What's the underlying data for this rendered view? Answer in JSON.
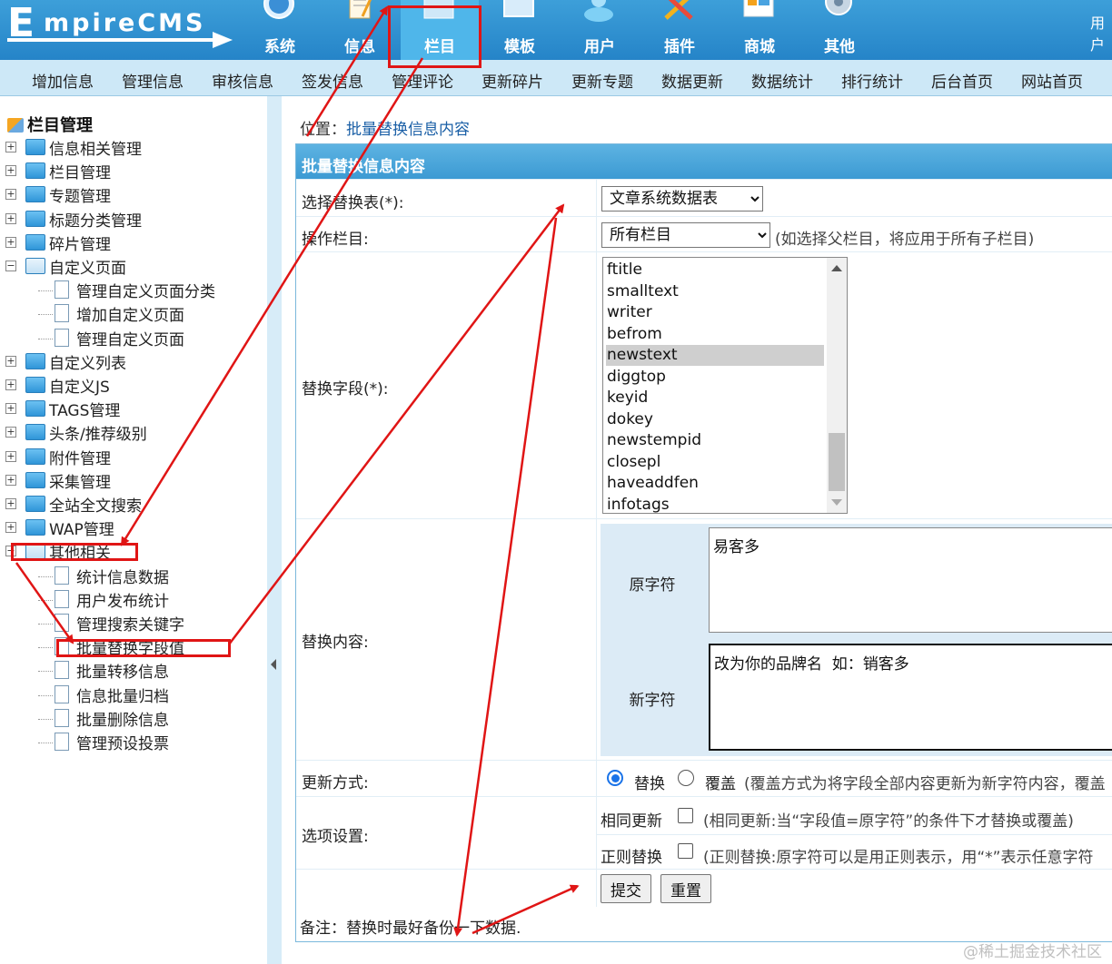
{
  "logo": {
    "e": "E",
    "text": "mpireCMS"
  },
  "nav_tabs": [
    {
      "label": "系统",
      "icon": "globe-icon"
    },
    {
      "label": "信息",
      "icon": "notepad-icon"
    },
    {
      "label": "栏目",
      "icon": "folder-icon",
      "active": true
    },
    {
      "label": "模板",
      "icon": "window-icon"
    },
    {
      "label": "用户",
      "icon": "user-icon"
    },
    {
      "label": "插件",
      "icon": "tools-icon"
    },
    {
      "label": "商城",
      "icon": "shop-icon"
    },
    {
      "label": "其他",
      "icon": "gear-icon"
    }
  ],
  "user_text": "用户",
  "submenu": [
    "增加信息",
    "管理信息",
    "审核信息",
    "签发信息",
    "管理评论",
    "更新碎片",
    "更新专题",
    "数据更新",
    "数据统计",
    "排行统计",
    "后台首页",
    "网站首页"
  ],
  "tree": {
    "title": "栏目管理",
    "items": [
      {
        "label": "信息相关管理",
        "type": "folder",
        "pm": "+"
      },
      {
        "label": "栏目管理",
        "type": "folder",
        "pm": "+"
      },
      {
        "label": "专题管理",
        "type": "folder",
        "pm": "+"
      },
      {
        "label": "标题分类管理",
        "type": "folder",
        "pm": "+"
      },
      {
        "label": "碎片管理",
        "type": "folder",
        "pm": "+"
      },
      {
        "label": "自定义页面",
        "type": "folder-open",
        "pm": "−"
      },
      {
        "label": "管理自定义页面分类",
        "type": "doc"
      },
      {
        "label": "增加自定义页面",
        "type": "doc"
      },
      {
        "label": "管理自定义页面",
        "type": "doc"
      },
      {
        "label": "自定义列表",
        "type": "folder",
        "pm": "+"
      },
      {
        "label": "自定义JS",
        "type": "folder",
        "pm": "+"
      },
      {
        "label": "TAGS管理",
        "type": "folder",
        "pm": "+"
      },
      {
        "label": "头条/推荐级别",
        "type": "folder",
        "pm": "+"
      },
      {
        "label": "附件管理",
        "type": "folder",
        "pm": "+"
      },
      {
        "label": "采集管理",
        "type": "folder",
        "pm": "+"
      },
      {
        "label": "全站全文搜索",
        "type": "folder",
        "pm": "+"
      },
      {
        "label": "WAP管理",
        "type": "folder",
        "pm": "+"
      },
      {
        "label": "其他相关",
        "type": "folder-open",
        "pm": "−"
      },
      {
        "label": "统计信息数据",
        "type": "doc"
      },
      {
        "label": "用户发布统计",
        "type": "doc"
      },
      {
        "label": "管理搜索关键字",
        "type": "doc"
      },
      {
        "label": "批量替换字段值",
        "type": "doc"
      },
      {
        "label": "批量转移信息",
        "type": "doc"
      },
      {
        "label": "信息批量归档",
        "type": "doc"
      },
      {
        "label": "批量删除信息",
        "type": "doc"
      },
      {
        "label": "管理预设投票",
        "type": "doc"
      }
    ]
  },
  "crumb": {
    "prefix": "位置：",
    "link": "批量替换信息内容"
  },
  "form": {
    "title": "批量替换信息内容",
    "table_label": "选择替换表(*):",
    "table_value": "文章系统数据表",
    "column_label": "操作栏目:",
    "column_value": "所有栏目",
    "column_hint": "(如选择父栏目，将应用于所有子栏目)",
    "field_label": "替换字段(*):",
    "field_options": [
      "ftitle",
      "smalltext",
      "writer",
      "befrom",
      "newstext",
      "diggtop",
      "keyid",
      "dokey",
      "newstempid",
      "closepl",
      "haveaddfen",
      "infotags"
    ],
    "field_selected": "newstext",
    "content_label": "替换内容:",
    "orig_label": "原字符",
    "orig_value": "易客多",
    "new_label": "新字符",
    "new_value": "改为你的品牌名  如：销客多",
    "mode_label": "更新方式:",
    "mode_replace": "替换",
    "mode_cover": "覆盖",
    "mode_hint": "(覆盖方式为将字段全部内容更新为新字符内容，覆盖",
    "opt_label": "选项设置:",
    "same_label": "相同更新",
    "same_hint": "(相同更新:当“字段值=原字符”的条件下才替换或覆盖)",
    "regex_label": "正则替换",
    "regex_hint": "(正则替换:原字符可以是用正则表示，用“*”表示任意字符",
    "submit": "提交",
    "reset": "重置"
  },
  "note": "备注：替换时最好备份一下数据.",
  "watermark": "@稀土掘金技术社区",
  "colors": {
    "header": "#2584c8",
    "active_tab": "#4fb6ea",
    "annotation": "#e01515"
  }
}
